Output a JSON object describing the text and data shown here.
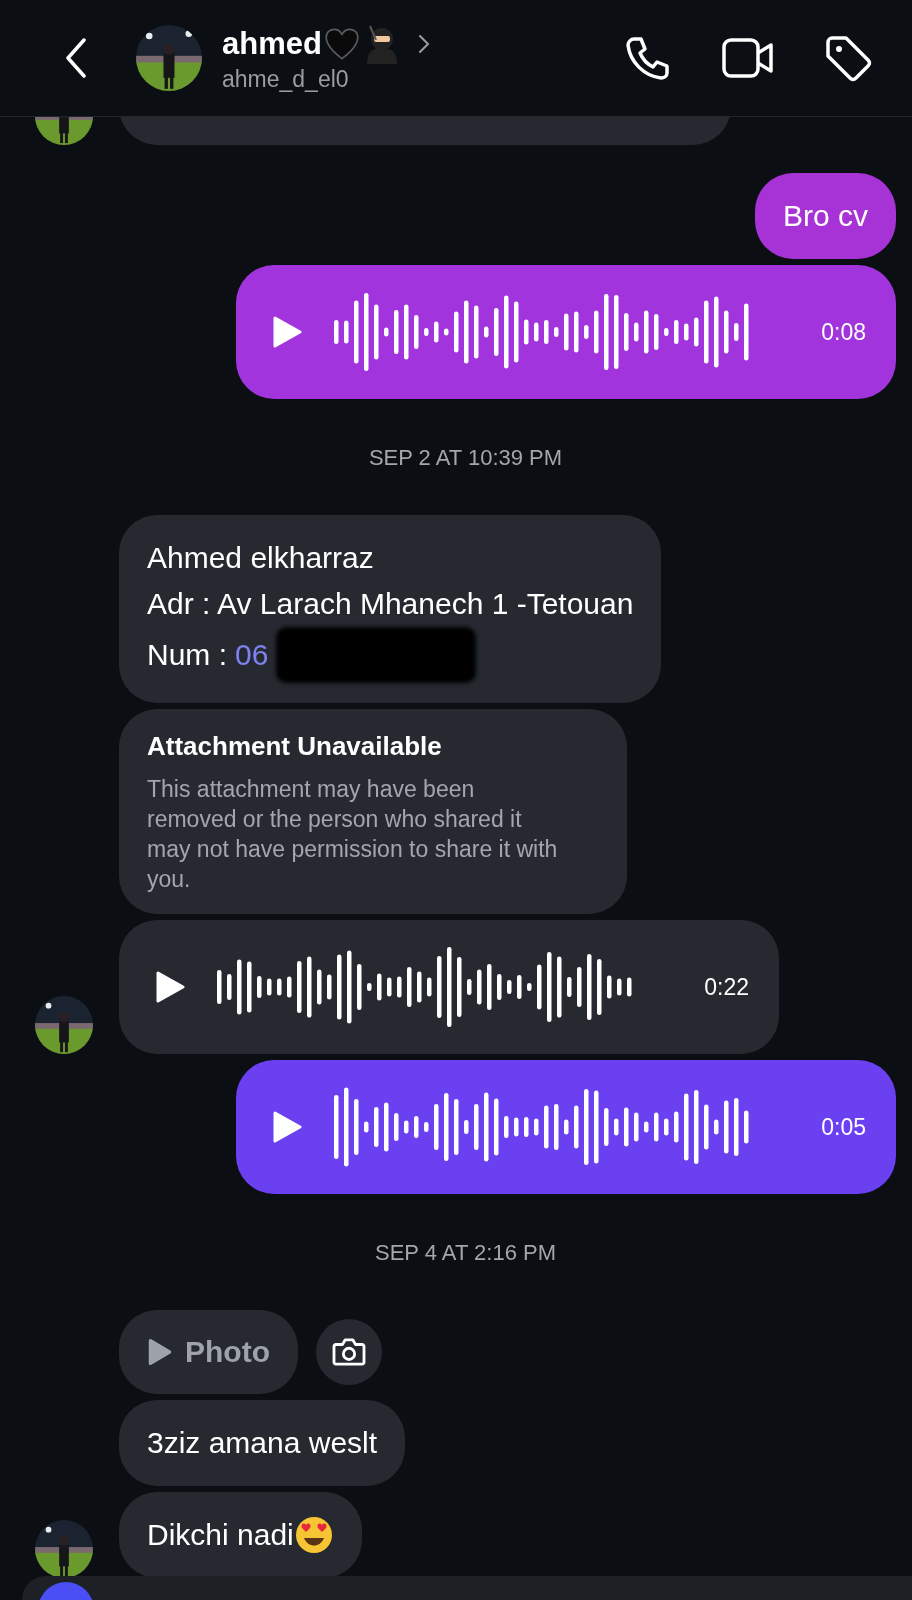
{
  "header": {
    "name": "ahmed",
    "username": "ahme_d_el0"
  },
  "messages": [
    {
      "kind": "cut_off",
      "outgoing": false,
      "avatar": true
    },
    {
      "kind": "text",
      "outgoing": true,
      "lines": [
        "Bro cv"
      ],
      "color": "#a732d6"
    },
    {
      "kind": "voice",
      "outgoing": true,
      "duration": "0:08",
      "color": "#a134dc"
    },
    {
      "kind": "timestamp",
      "text": "SEP 2 AT 10:39 PM"
    },
    {
      "kind": "contact",
      "outgoing": false,
      "lines": [
        "Ahmed elkharraz",
        "Adr : Av Larach Mhanech 1 -Tetouan"
      ],
      "num_label": "Num :",
      "num_value": "06"
    },
    {
      "kind": "unavailable",
      "outgoing": false,
      "title": "Attachment Unavailable",
      "body": "This attachment may have been removed or the person who shared it may not have permission to share it with you."
    },
    {
      "kind": "voice",
      "outgoing": false,
      "duration": "0:22",
      "avatar": true
    },
    {
      "kind": "voice",
      "outgoing": true,
      "duration": "0:05",
      "color": "#6b40f0"
    },
    {
      "kind": "timestamp",
      "text": "SEP 4 AT 2:16 PM"
    },
    {
      "outgoing": false,
      "label": "Photo"
    },
    {
      "kind": "text",
      "outgoing": false,
      "lines": [
        "3ziz amana weslt"
      ],
      "avatar": false
    },
    {
      "kind": "text",
      "outgoing": false,
      "lines": [
        "Dikchi nadi"
      ],
      "has_emoji": true,
      "avatar": true
    }
  ]
}
